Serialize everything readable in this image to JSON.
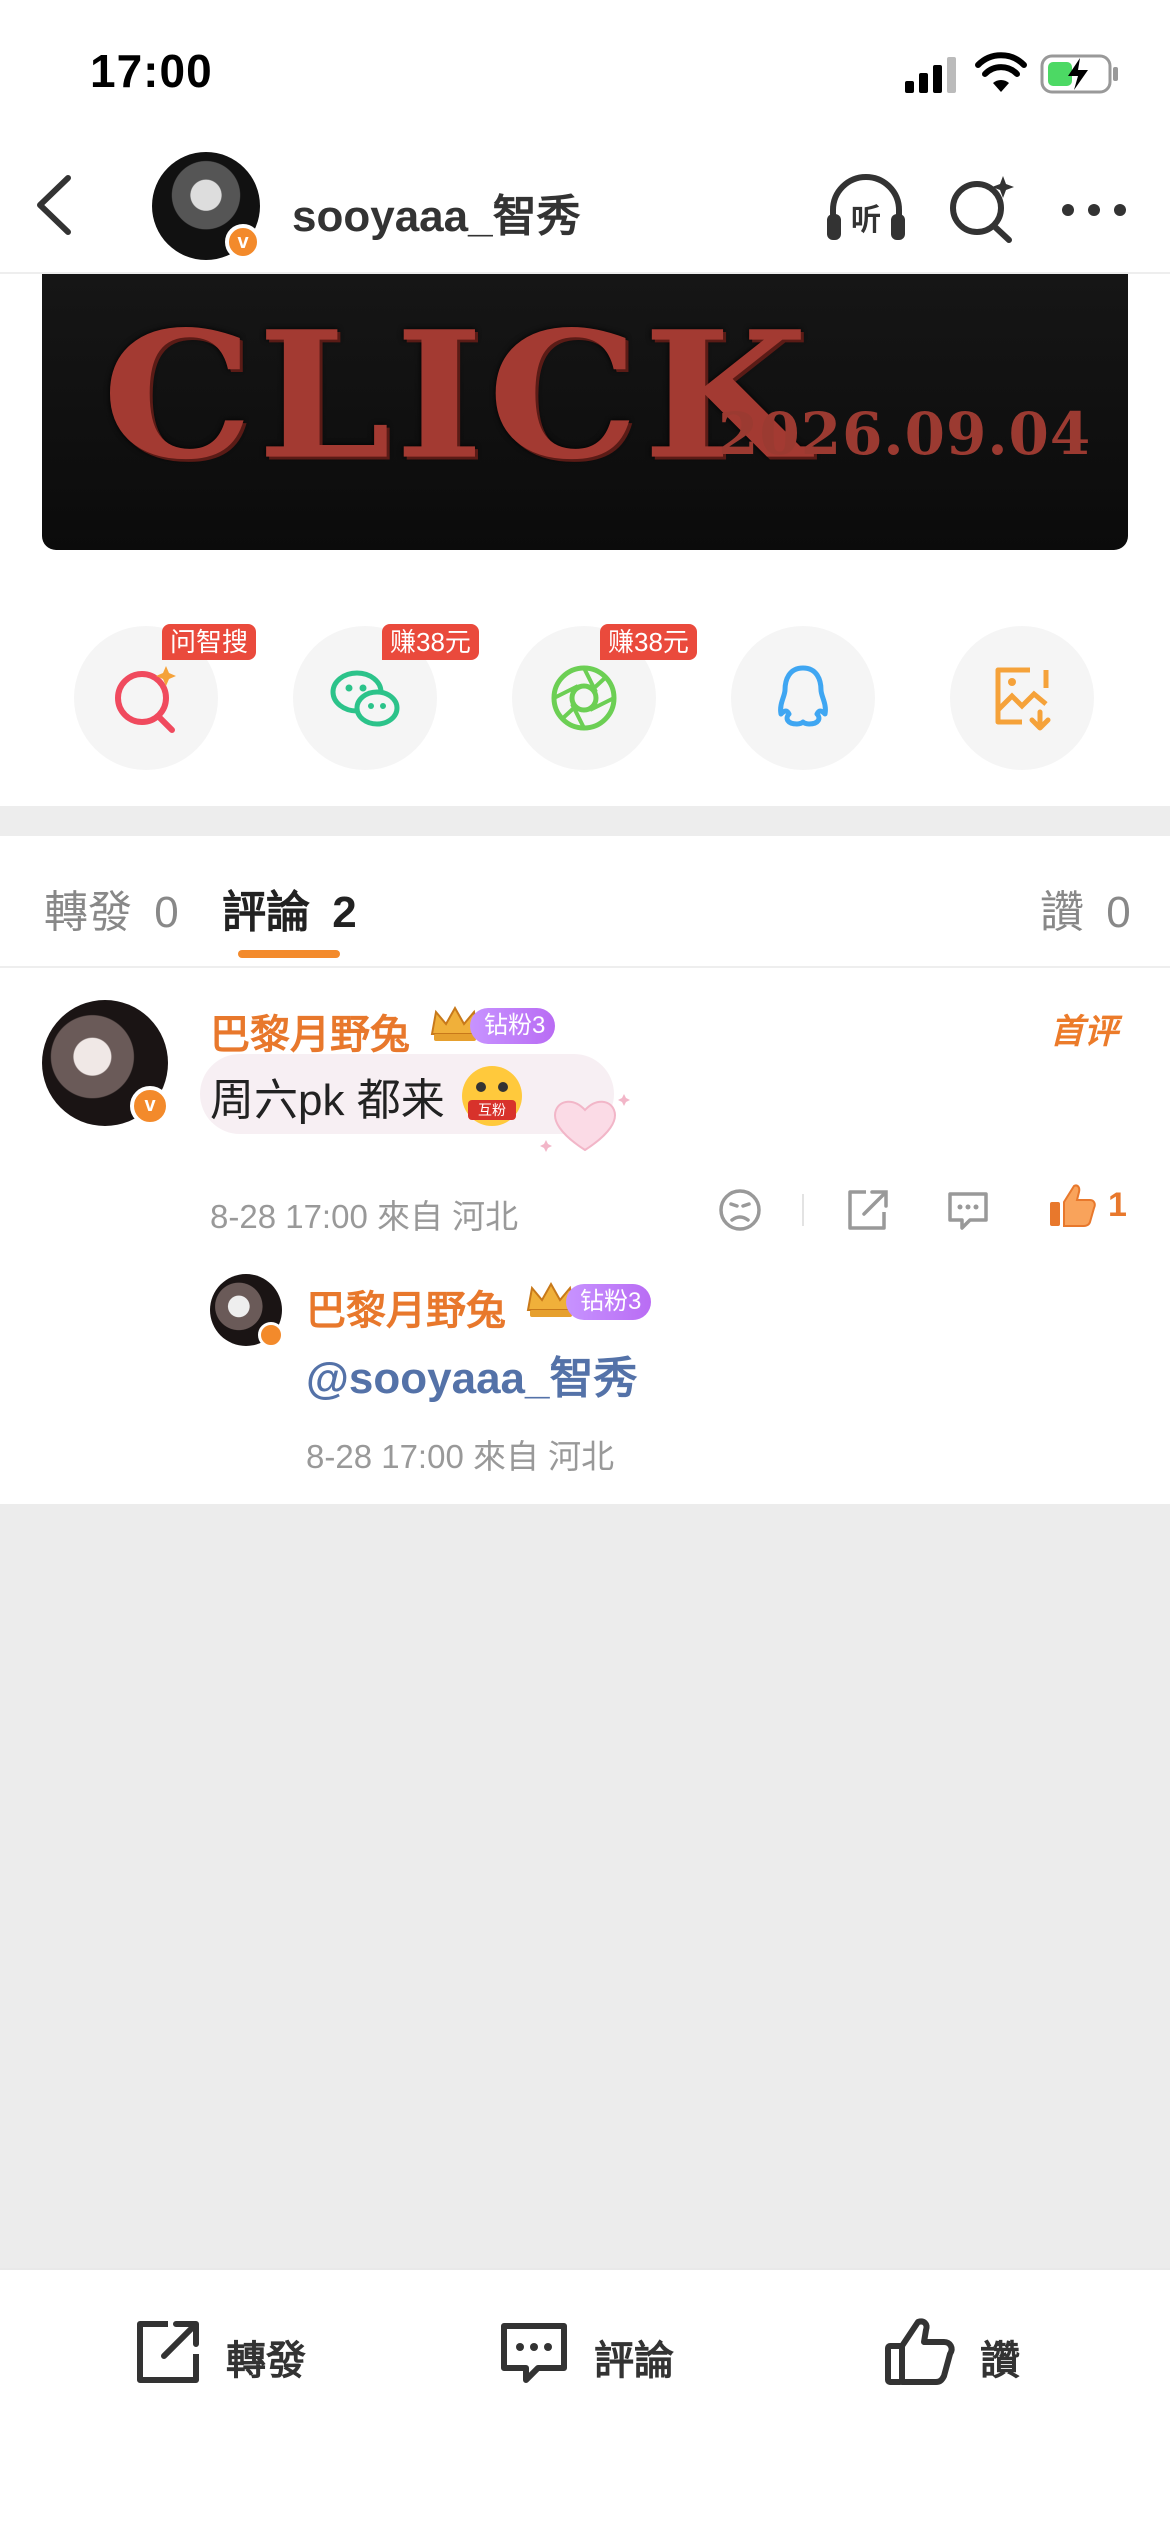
{
  "status": {
    "time": "17:00"
  },
  "header": {
    "username": "sooyaaa_智秀",
    "listen_label": "听"
  },
  "banner": {
    "word": "CLICK",
    "date": "2026.09.04"
  },
  "share": {
    "tags": [
      "问智搜",
      "赚38元",
      "赚38元"
    ],
    "icons": [
      "ai-search-icon",
      "wechat-icon",
      "moments-icon",
      "qq-icon",
      "save-image-icon"
    ]
  },
  "tabs": {
    "repost": "轉發",
    "repost_count": "0",
    "comment": "評論",
    "comment_count": "2",
    "like": "讚",
    "like_count": "0"
  },
  "comments": [
    {
      "author": "巴黎月野兔",
      "fan_badge": "钻粉3",
      "first_label": "首评",
      "text": "周六pk 都来",
      "emoji_label": "互粉",
      "meta": "8-28 17:00  來自 河北",
      "likes": "1",
      "reply": {
        "author": "巴黎月野兔",
        "fan_badge": "钻粉3",
        "text": "@sooyaaa_智秀",
        "meta": "8-28 17:00  來自 河北"
      }
    }
  ],
  "bottombar": {
    "repost": "轉發",
    "comment": "評論",
    "like": "讚"
  }
}
